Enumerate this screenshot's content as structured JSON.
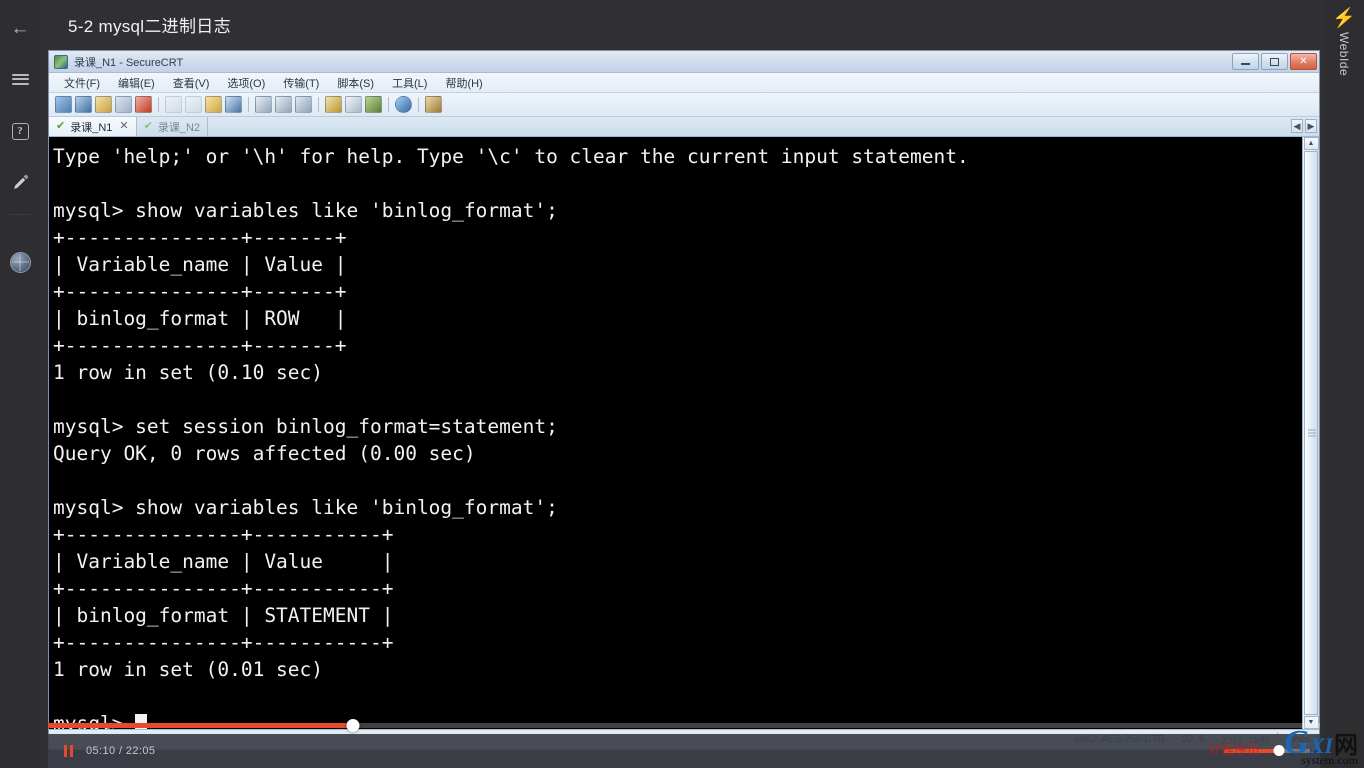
{
  "page": {
    "title": "5-2 mysql二进制日志",
    "background_color": "#303033"
  },
  "left_rail": {
    "back_icon": "←",
    "items": [
      {
        "name": "menu",
        "icon": "hamburger-icon"
      },
      {
        "name": "help",
        "icon": "question-mark-icon",
        "glyph": "?"
      },
      {
        "name": "note",
        "icon": "pencil-icon",
        "glyph": "✎"
      },
      {
        "name": "account",
        "icon": "globe-avatar-icon"
      }
    ]
  },
  "right_rail": {
    "bolt_glyph": "⚡",
    "label": "WebIde",
    "accent_color": "#3ea8f5"
  },
  "crt_window": {
    "title": "录课_N1 - SecureCRT",
    "window_buttons": {
      "minimize": "minimize-button",
      "maximize": "maximize-button",
      "close": "✕"
    },
    "menu": [
      "文件(F)",
      "编辑(E)",
      "查看(V)",
      "选项(O)",
      "传输(T)",
      "脚本(S)",
      "工具(L)",
      "帮助(H)"
    ],
    "toolbar_icons": [
      "connect-icon",
      "quick-connect-icon",
      "open-session-icon",
      "clone-session-icon",
      "disconnect-icon",
      "sep",
      "print-icon",
      "copy-icon",
      "paste-icon",
      "find-icon",
      "sep",
      "transfer-receive-icon",
      "transfer-send-icon",
      "upload-icon",
      "sep",
      "log-session-icon",
      "settings-icon",
      "key-icon",
      "sep",
      "help-icon",
      "sep",
      "window-icon"
    ],
    "tabs": [
      {
        "label": "录课_N1",
        "active": true,
        "check": "✔",
        "close": "✕"
      },
      {
        "label": "录课_N2",
        "active": false,
        "check": "✔",
        "close": ""
      }
    ],
    "tab_nav": {
      "left": "◀",
      "right": "▶"
    },
    "status": {
      "protocol": "ssh2: AES-256-CTR",
      "cursor_pos": "22, 8",
      "dimensions": "22行, 79列",
      "terminal_type": "Linux"
    },
    "terminal": {
      "background": "#000000",
      "foreground": "#f2f2f2",
      "lines": [
        "Type 'help;' or '\\h' for help. Type '\\c' to clear the current input statement.",
        "",
        "mysql> show variables like 'binlog_format';",
        "+---------------+-------+",
        "| Variable_name | Value |",
        "+---------------+-------+",
        "| binlog_format | ROW   |",
        "+---------------+-------+",
        "1 row in set (0.10 sec)",
        "",
        "mysql> set session binlog_format=statement;",
        "Query OK, 0 rows affected (0.00 sec)",
        "",
        "mysql> show variables like 'binlog_format';",
        "+---------------+-----------+",
        "| Variable_name | Value     |",
        "+---------------+-----------+",
        "| binlog_format | STATEMENT |",
        "+---------------+-----------+",
        "1 row in set (0.01 sec)",
        ""
      ],
      "prompt": "mysql> "
    }
  },
  "video": {
    "played_percent": 24,
    "progress_color": "#e8492b",
    "pause_icon": "pause-icon",
    "time_display": "05:10 / 22:05",
    "volume_percent": 64
  },
  "watermark": {
    "g": "G",
    "xi": "XI",
    "net": "网",
    "sub": "system.com",
    "red_text": "好程序员"
  }
}
